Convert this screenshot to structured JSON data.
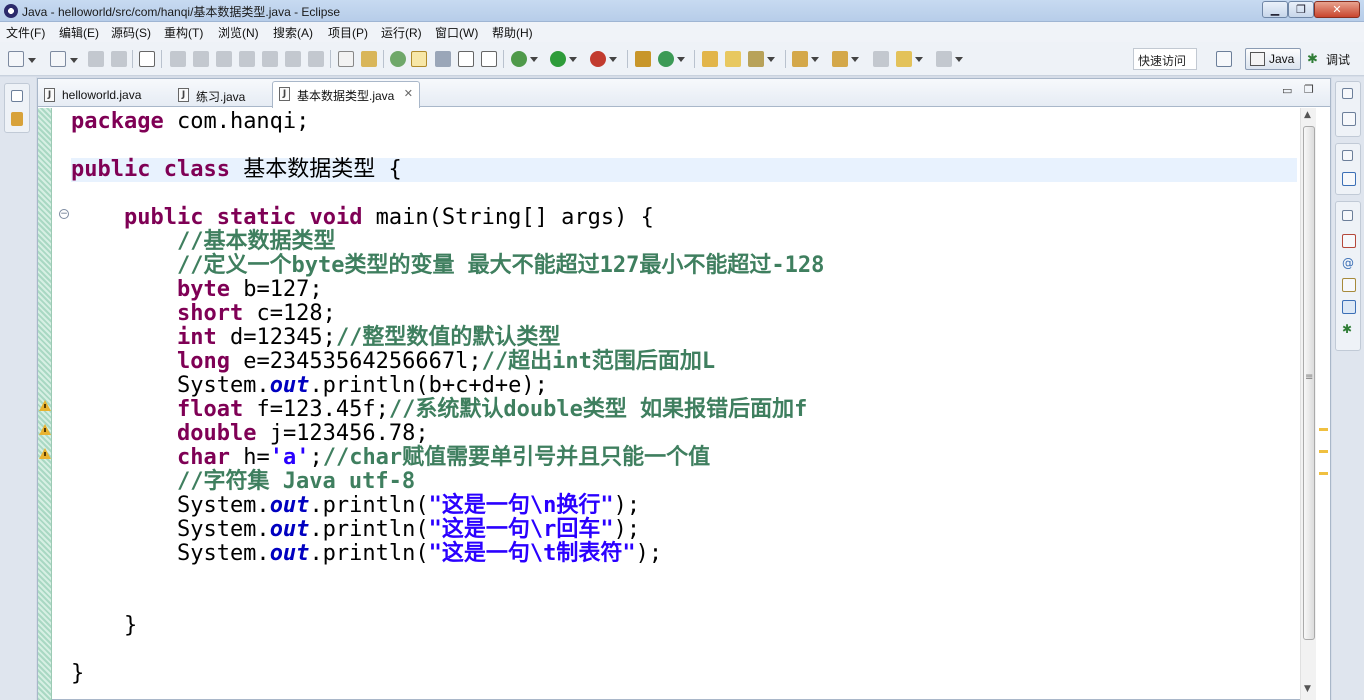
{
  "window": {
    "title": "Java - helloworld/src/com/hanqi/基本数据类型.java - Eclipse",
    "minimize_glyph": "▁",
    "maximize_glyph": "❐",
    "close_glyph": "✕"
  },
  "menu": [
    "文件(F)",
    "编辑(E)",
    "源码(S)",
    "重构(T)",
    "浏览(N)",
    "搜索(A)",
    "项目(P)",
    "运行(R)",
    "窗口(W)",
    "帮助(H)"
  ],
  "toolbar": {
    "quick_access": "快速访问",
    "perspective_java": "Java",
    "perspective_debug": "调试"
  },
  "editor": {
    "tabs": [
      {
        "label": "helloworld.java",
        "active": false
      },
      {
        "label": "练习.java",
        "active": false
      },
      {
        "label": "基本数据类型.java",
        "active": true
      }
    ],
    "tab_close_glyph": "✕",
    "minimize_glyph": "▭",
    "maximize_glyph": "❐",
    "fold_glyph": "−",
    "code_lines": [
      [
        {
          "t": "kw",
          "v": "package"
        },
        {
          "t": "tx",
          "v": " com.hanqi;"
        }
      ],
      [],
      [
        {
          "t": "kw",
          "v": "public"
        },
        {
          "t": "tx",
          "v": " "
        },
        {
          "t": "kw",
          "v": "class"
        },
        {
          "t": "tx",
          "v": " 基本数据类型 {"
        }
      ],
      [],
      [
        {
          "t": "tx",
          "v": "    "
        },
        {
          "t": "kw",
          "v": "public"
        },
        {
          "t": "tx",
          "v": " "
        },
        {
          "t": "kw",
          "v": "static"
        },
        {
          "t": "tx",
          "v": " "
        },
        {
          "t": "kw",
          "v": "void"
        },
        {
          "t": "tx",
          "v": " main(String[] args) {"
        }
      ],
      [
        {
          "t": "tx",
          "v": "        "
        },
        {
          "t": "cm",
          "v": "//基本数据类型"
        }
      ],
      [
        {
          "t": "tx",
          "v": "        "
        },
        {
          "t": "cm",
          "v": "//定义一个byte类型的变量 最大不能超过127最小不能超过-128"
        }
      ],
      [
        {
          "t": "tx",
          "v": "        "
        },
        {
          "t": "kw",
          "v": "byte"
        },
        {
          "t": "tx",
          "v": " b=127;"
        }
      ],
      [
        {
          "t": "tx",
          "v": "        "
        },
        {
          "t": "kw",
          "v": "short"
        },
        {
          "t": "tx",
          "v": " c=128;"
        }
      ],
      [
        {
          "t": "tx",
          "v": "        "
        },
        {
          "t": "kw",
          "v": "int"
        },
        {
          "t": "tx",
          "v": " d=12345;"
        },
        {
          "t": "cm",
          "v": "//整型数值的默认类型"
        }
      ],
      [
        {
          "t": "tx",
          "v": "        "
        },
        {
          "t": "kw",
          "v": "long"
        },
        {
          "t": "tx",
          "v": " e=23453564256667l;"
        },
        {
          "t": "cm",
          "v": "//超出int范围后面加L"
        }
      ],
      [
        {
          "t": "tx",
          "v": "        System."
        },
        {
          "t": "fd",
          "v": "out"
        },
        {
          "t": "tx",
          "v": ".println(b+c+d+e);"
        }
      ],
      [
        {
          "t": "tx",
          "v": "        "
        },
        {
          "t": "kw",
          "v": "float"
        },
        {
          "t": "tx",
          "v": " f=123.45f;"
        },
        {
          "t": "cm",
          "v": "//系统默认double类型 如果报错后面加f"
        }
      ],
      [
        {
          "t": "tx",
          "v": "        "
        },
        {
          "t": "kw",
          "v": "double"
        },
        {
          "t": "tx",
          "v": " j=123456.78;"
        }
      ],
      [
        {
          "t": "tx",
          "v": "        "
        },
        {
          "t": "kw",
          "v": "char"
        },
        {
          "t": "tx",
          "v": " h="
        },
        {
          "t": "st",
          "v": "'a'"
        },
        {
          "t": "tx",
          "v": ";"
        },
        {
          "t": "cm",
          "v": "//char赋值需要单引号并且只能一个值"
        }
      ],
      [
        {
          "t": "tx",
          "v": "        "
        },
        {
          "t": "cm",
          "v": "//字符集 Java utf-8"
        }
      ],
      [
        {
          "t": "tx",
          "v": "        System."
        },
        {
          "t": "fd",
          "v": "out"
        },
        {
          "t": "tx",
          "v": ".println("
        },
        {
          "t": "st",
          "v": "\"这是一句\\n换行\""
        },
        {
          "t": "tx",
          "v": ");"
        }
      ],
      [
        {
          "t": "tx",
          "v": "        System."
        },
        {
          "t": "fd",
          "v": "out"
        },
        {
          "t": "tx",
          "v": ".println("
        },
        {
          "t": "st",
          "v": "\"这是一句\\r回车\""
        },
        {
          "t": "tx",
          "v": ");"
        }
      ],
      [
        {
          "t": "tx",
          "v": "        System."
        },
        {
          "t": "fd",
          "v": "out"
        },
        {
          "t": "tx",
          "v": ".println("
        },
        {
          "t": "st",
          "v": "\"这是一句\\t制表符\""
        },
        {
          "t": "tx",
          "v": ");"
        }
      ],
      [],
      [],
      [
        {
          "t": "tx",
          "v": "    }"
        }
      ],
      [],
      [
        {
          "t": "tx",
          "v": "}"
        }
      ]
    ],
    "current_line": 2,
    "warning_lines": [
      12,
      13,
      14
    ]
  },
  "colors": {
    "keyword": "#7f0055",
    "comment": "#3f7f5f",
    "field": "#0000c0",
    "string": "#2a00ff",
    "current_line": "#e8f2fe"
  }
}
